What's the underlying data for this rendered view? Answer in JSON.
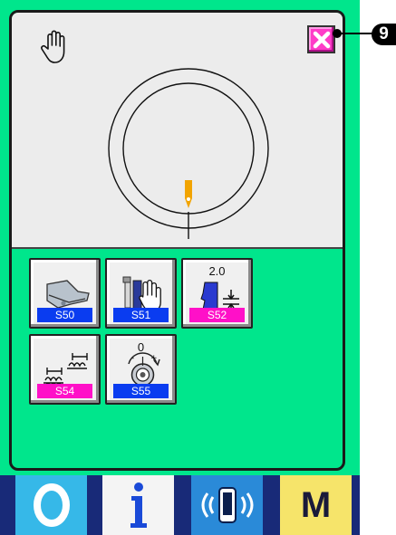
{
  "callout": {
    "number": "9"
  },
  "display": {
    "hand_icon": "hand-icon",
    "close_icon": "close-icon",
    "gauge_icon": "bobbin-circle-indicator"
  },
  "tiles": [
    {
      "value": "",
      "code": "S50",
      "code_color": "#0a3cf0",
      "icon": "presser-foot-icon"
    },
    {
      "value": "",
      "code": "S51",
      "code_color": "#0a3cf0",
      "icon": "needle-hand-icon"
    },
    {
      "value": "2.0",
      "code": "S52",
      "code_color": "#ff10c8",
      "icon": "stitch-length-icon"
    },
    {
      "value": "",
      "code": "S54",
      "code_color": "#ff10c8",
      "icon": "stitch-pattern-icon"
    },
    {
      "value": "0",
      "code": "S55",
      "code_color": "#0a3cf0",
      "icon": "tension-dial-icon"
    }
  ],
  "bottom_bar": {
    "buttons": [
      {
        "icon": "ready-icon"
      },
      {
        "icon": "info-icon",
        "label": "i"
      },
      {
        "icon": "communication-icon"
      },
      {
        "icon": "mode-icon",
        "label": "M"
      }
    ]
  },
  "colors": {
    "panel_green": "#00e68c",
    "display_gray": "#ececec",
    "code_blue": "#0a3cf0",
    "code_pink": "#ff10c8",
    "close_pink": "#ff3cc8",
    "bottom_navy": "#182a78"
  }
}
